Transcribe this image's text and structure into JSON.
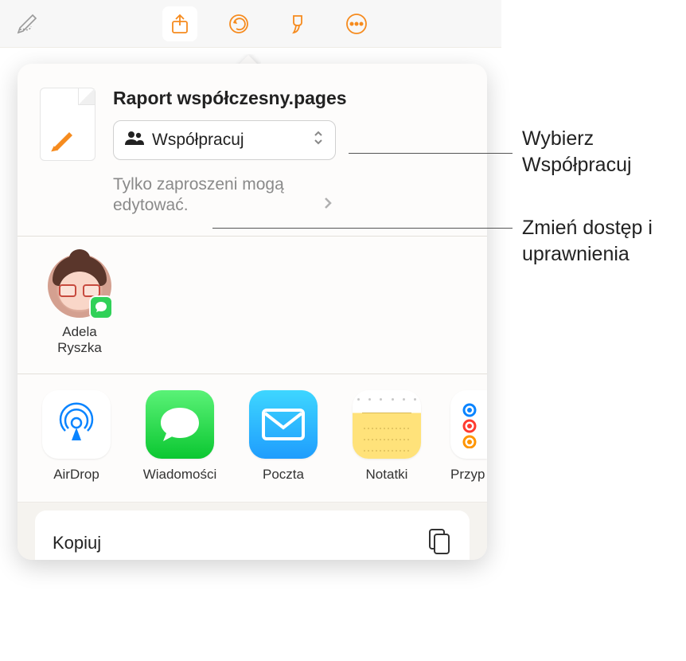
{
  "document": {
    "title": "Raport współczesny.pages"
  },
  "collaborate": {
    "label": "Współpracuj"
  },
  "permissions": {
    "text": "Tylko zaproszeni mogą edytować."
  },
  "contacts": [
    {
      "name": "Adela Ryszka"
    }
  ],
  "apps": [
    {
      "label": "AirDrop"
    },
    {
      "label": "Wiadomości"
    },
    {
      "label": "Poczta"
    },
    {
      "label": "Notatki"
    },
    {
      "label": "Przyp"
    }
  ],
  "actions": {
    "copy": "Kopiuj"
  },
  "callouts": {
    "chooseCollab": "Wybierz Współpracuj",
    "changeAccess": "Zmień dostęp i uprawnienia"
  }
}
